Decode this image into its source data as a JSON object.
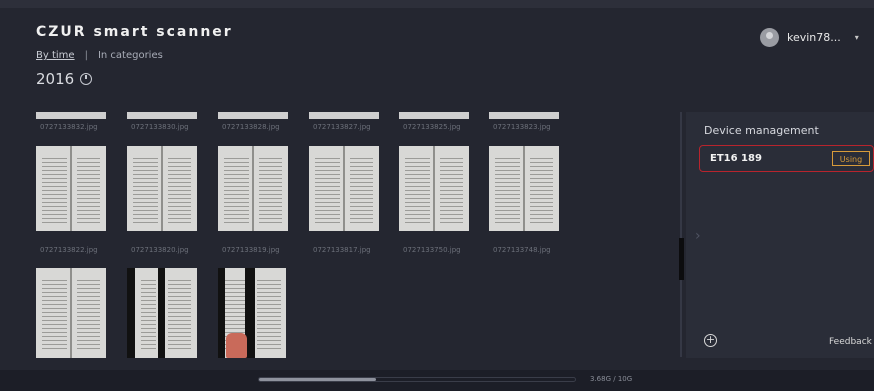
{
  "app": {
    "title": "CZUR smart scanner"
  },
  "nav": {
    "by_time": "By time",
    "separator": "|",
    "in_categories": "In categories"
  },
  "year": {
    "label": "2016",
    "icon": "clock-icon"
  },
  "user": {
    "name": "kevin78...",
    "caret": "▾",
    "icon": "avatar-icon"
  },
  "gallery": {
    "top_row": [
      "0727133832.jpg",
      "0727133830.jpg",
      "0727133828.jpg",
      "0727133827.jpg",
      "0727133825.jpg",
      "0727133823.jpg"
    ],
    "middle_row": [
      "0727133822.jpg",
      "0727133820.jpg",
      "0727133819.jpg",
      "0727133817.jpg",
      "0727133750.jpg",
      "0727133748.jpg"
    ]
  },
  "device_panel": {
    "title": "Device management",
    "device_name": "ET16 189",
    "status": "Using",
    "chevron": "›",
    "add": "+",
    "feedback": "Feedback"
  },
  "storage": {
    "used_fraction": 0.37,
    "label": "3.68G / 10G"
  },
  "colors": {
    "background": "#242630",
    "panel": "#2a2d38",
    "accent_red": "#b8242d",
    "accent_orange": "#d79b3a"
  }
}
